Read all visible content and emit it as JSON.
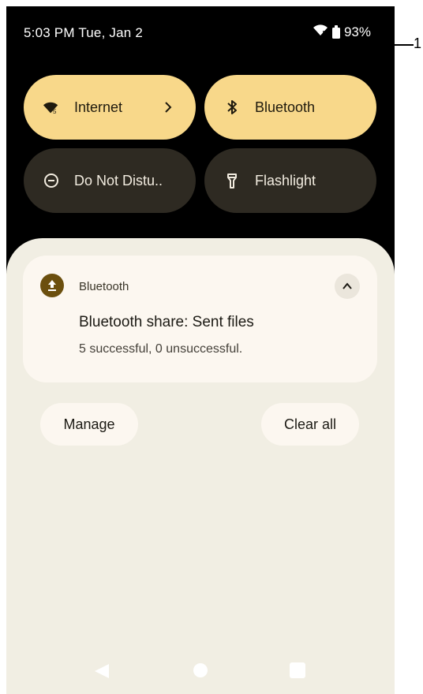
{
  "status_bar": {
    "time_date": "5:03 PM Tue, Jan 2",
    "battery_percent": "93%",
    "wifi_icon": "wifi-5-icon",
    "battery_icon": "battery-icon"
  },
  "quick_settings": {
    "tiles": [
      {
        "label": "Internet",
        "icon": "wifi-5-icon",
        "state": "on",
        "has_chevron": true
      },
      {
        "label": "Bluetooth",
        "icon": "bluetooth-icon",
        "state": "on"
      },
      {
        "label": "Do Not Distu..",
        "icon": "do-not-disturb-icon",
        "state": "off"
      },
      {
        "label": "Flashlight",
        "icon": "flashlight-icon",
        "state": "off"
      }
    ]
  },
  "notification": {
    "app_name": "Bluetooth",
    "app_icon": "upload-icon",
    "title": "Bluetooth share: Sent files",
    "text": "5 successful, 0 unsuccessful.",
    "expand_icon": "chevron-up-icon"
  },
  "actions": {
    "manage_label": "Manage",
    "clear_all_label": "Clear all"
  },
  "navigation": {
    "back_icon": "back-triangle-icon",
    "home_icon": "home-circle-icon",
    "recent_icon": "recents-square-icon"
  },
  "callout": {
    "label": "1"
  },
  "colors": {
    "tile_on": "#f8d88a",
    "tile_off": "#2e2a22",
    "shade_background": "#f1eee3",
    "card_background": "#fcf7f0",
    "app_icon_background": "#6b4f0e"
  }
}
